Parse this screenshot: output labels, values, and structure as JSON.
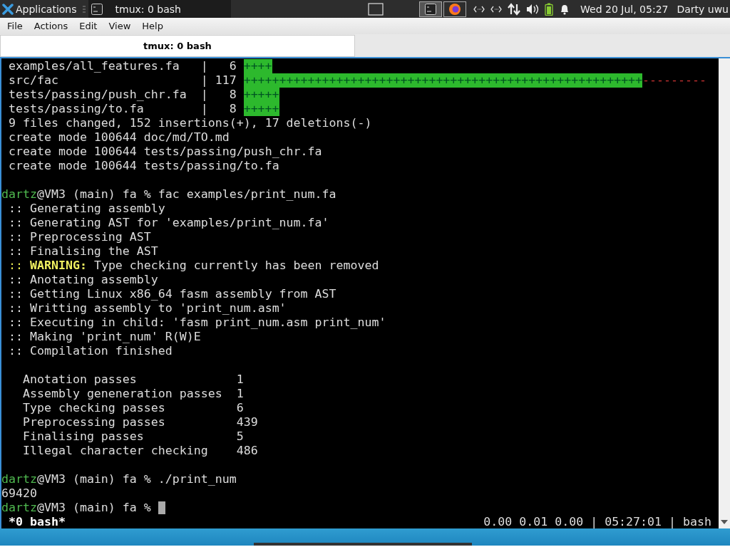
{
  "panel": {
    "app_menu": "Applications",
    "task": "tmux: 0 bash",
    "clock": "Wed 20 Jul, 05:27",
    "user": "Darty uwu"
  },
  "menu": [
    "File",
    "Actions",
    "Edit",
    "View",
    "Help"
  ],
  "tabs": [
    {
      "label": "tmux: 0 bash",
      "selected": true
    }
  ],
  "terminal": {
    "lines": [
      {
        "kind": "diffstat",
        "path": "examples/all_features.fa",
        "separator": "|",
        "count": "6",
        "plus": "++++"
      },
      {
        "kind": "diffstat",
        "path": "src/fac",
        "separator": "|",
        "count": "117",
        "plus": "++++++++++++++++++++++++++++++++++++++++++++++++++++++++",
        "minus": "---------"
      },
      {
        "kind": "diffstat",
        "path": "tests/passing/push_chr.fa",
        "separator": "|",
        "count": "8",
        "plus": "+++++"
      },
      {
        "kind": "diffstat",
        "path": "tests/passing/to.fa",
        "separator": "|",
        "count": "8",
        "plus": "+++++"
      },
      {
        "kind": "text",
        "segments": [
          {
            "text": " 9 files changed, 152 insertions(+), 17 deletions(-)",
            "kind": "plain"
          }
        ]
      },
      {
        "kind": "text",
        "segments": [
          {
            "text": " create mode 100644 doc/md/TO.md",
            "kind": "plain"
          }
        ]
      },
      {
        "kind": "text",
        "segments": [
          {
            "text": " create mode 100644 tests/passing/push_chr.fa",
            "kind": "plain"
          }
        ]
      },
      {
        "kind": "text",
        "segments": [
          {
            "text": " create mode 100644 tests/passing/to.fa",
            "kind": "plain"
          }
        ]
      },
      {
        "kind": "blank"
      },
      {
        "kind": "text",
        "segments": [
          {
            "text": "dartz",
            "kind": "user"
          },
          {
            "text": "@VM3 (main) fa % fac examples/print_num.fa",
            "kind": "plain"
          }
        ]
      },
      {
        "kind": "text",
        "segments": [
          {
            "text": " :: Generating assembly",
            "kind": "plain"
          }
        ]
      },
      {
        "kind": "text",
        "segments": [
          {
            "text": " :: Generating AST for 'examples/print_num.fa'",
            "kind": "plain"
          }
        ]
      },
      {
        "kind": "text",
        "segments": [
          {
            "text": " :: Preprocessing AST",
            "kind": "plain"
          }
        ]
      },
      {
        "kind": "text",
        "segments": [
          {
            "text": " :: Finalising the AST",
            "kind": "plain"
          }
        ]
      },
      {
        "kind": "text",
        "segments": [
          {
            "text": " ::",
            "kind": "warn"
          },
          {
            "text": " WARNING:",
            "kind": "warn-bold"
          },
          {
            "text": " Type checking currently has been removed",
            "kind": "plain"
          }
        ]
      },
      {
        "kind": "text",
        "segments": [
          {
            "text": " :: Anotating assembly",
            "kind": "plain"
          }
        ]
      },
      {
        "kind": "text",
        "segments": [
          {
            "text": " :: Getting Linux x86_64 fasm assembly from AST",
            "kind": "plain"
          }
        ]
      },
      {
        "kind": "text",
        "segments": [
          {
            "text": " :: Writting assembly to 'print_num.asm'",
            "kind": "plain"
          }
        ]
      },
      {
        "kind": "text",
        "segments": [
          {
            "text": " :: Executing in child: 'fasm print_num.asm print_num'",
            "kind": "plain"
          }
        ]
      },
      {
        "kind": "text",
        "segments": [
          {
            "text": " :: Making 'print_num' R(W)E",
            "kind": "plain"
          }
        ]
      },
      {
        "kind": "text",
        "segments": [
          {
            "text": " :: Compilation finished",
            "kind": "plain"
          }
        ]
      },
      {
        "kind": "blank"
      },
      {
        "kind": "stat",
        "label": "Anotation passes",
        "value": "1"
      },
      {
        "kind": "stat",
        "label": "Assembly geneneration passes",
        "value": "1"
      },
      {
        "kind": "stat",
        "label": "Type checking passes",
        "value": "6"
      },
      {
        "kind": "stat",
        "label": "Preprocessing passes",
        "value": "439"
      },
      {
        "kind": "stat",
        "label": "Finalising passes",
        "value": "5"
      },
      {
        "kind": "stat",
        "label": "Illegal character checking",
        "value": "486"
      },
      {
        "kind": "blank"
      },
      {
        "kind": "text",
        "segments": [
          {
            "text": "dartz",
            "kind": "user"
          },
          {
            "text": "@VM3 (main) fa % ./print_num",
            "kind": "plain"
          }
        ]
      },
      {
        "kind": "text",
        "segments": [
          {
            "text": "69420",
            "kind": "plain"
          }
        ]
      },
      {
        "kind": "text",
        "cursor": true,
        "segments": [
          {
            "text": "dartz",
            "kind": "user"
          },
          {
            "text": "@VM3 (main) fa %",
            "kind": "plain"
          }
        ]
      }
    ]
  },
  "status_bar": {
    "window": "*0 bash*",
    "right": [
      "0.00 0.01 0.00",
      "|",
      "05:27:01",
      "|",
      "bash"
    ]
  }
}
